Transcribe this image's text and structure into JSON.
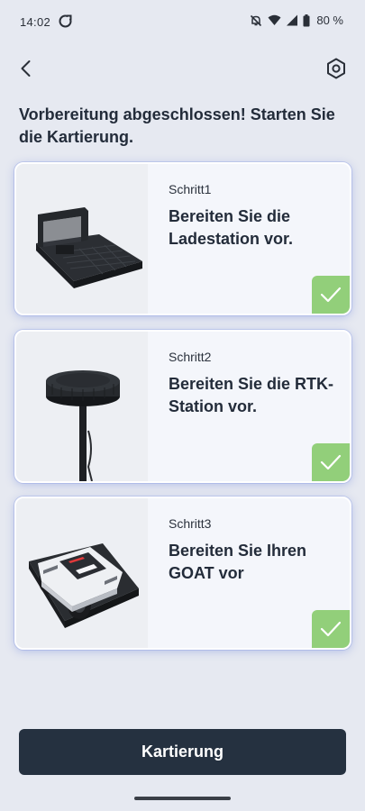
{
  "status_bar": {
    "time": "14:02",
    "battery_text": "80 %",
    "icons": [
      "sync-icon",
      "mute-icon",
      "wifi-icon",
      "signal-icon",
      "battery-icon"
    ]
  },
  "header": {
    "back_icon": "chevron-left-icon",
    "settings_icon": "hexagon-settings-icon"
  },
  "heading": "Vorbereitung abgeschlossen! Starten Sie die Kartierung.",
  "steps": [
    {
      "step": "Schritt1",
      "title": "Bereiten Sie die Ladestation vor.",
      "completed": true,
      "image": "charging-station"
    },
    {
      "step": "Schritt2",
      "title": "Bereiten Sie die RTK-Station vor.",
      "completed": true,
      "image": "rtk-antenna"
    },
    {
      "step": "Schritt3",
      "title": "Bereiten Sie Ihren GOAT vor",
      "completed": true,
      "image": "robot-mower"
    }
  ],
  "cta_label": "Kartierung",
  "colors": {
    "background": "#e6e9f1",
    "card": "#f4f6fb",
    "check_badge": "#92cf7a",
    "cta": "#253140",
    "text": "#232c3a"
  }
}
